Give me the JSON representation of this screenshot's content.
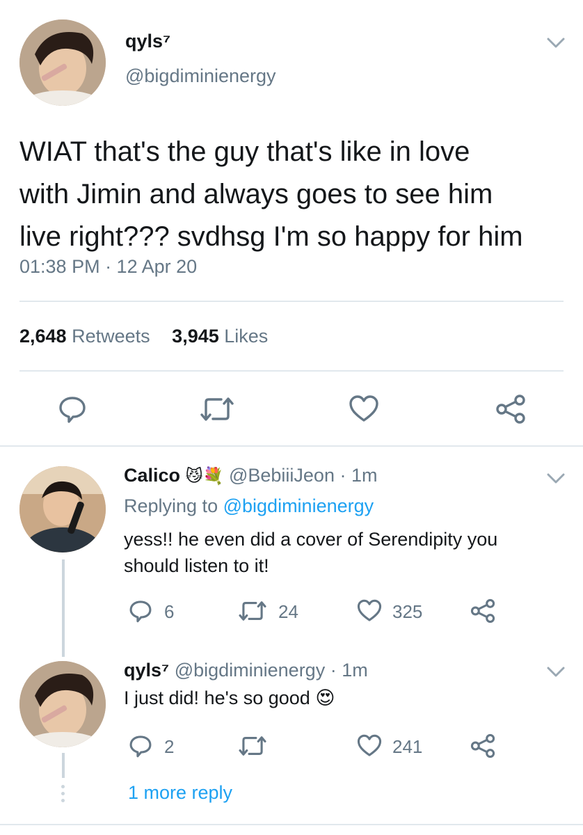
{
  "main_tweet": {
    "display_name": "qyls⁷",
    "handle": "@bigdiminienergy",
    "text_lines": [
      "WIAT that's the guy that's like in love",
      "with Jimin and always goes to see him",
      "live right??? svdhsg I'm so happy for him"
    ],
    "timestamp": "01:38 PM · 12 Apr 20",
    "retweets_count": "2,648",
    "retweets_label": "Retweets",
    "likes_count": "3,945",
    "likes_label": "Likes"
  },
  "reply1": {
    "display_name": "Calico",
    "emojis": "😼💐",
    "handle": "@BebiiiJeon",
    "time": "· 1m",
    "replying_label": "Replying to",
    "replying_handle": "@bigdiminienergy",
    "text_lines": [
      "yess!! he even did a cover of Serendipity you",
      "should listen to it!"
    ],
    "replies": "6",
    "retweets": "24",
    "likes": "325"
  },
  "reply2": {
    "display_name": "qyls⁷",
    "handle": "@bigdiminienergy",
    "time": "· 1m",
    "text": "I just did! he's so good",
    "emoji": "😍",
    "replies": "2",
    "likes": "241"
  },
  "more_replies_label": "1 more reply",
  "colors": {
    "accent": "#1da1f2",
    "secondary_text": "#657786",
    "divider": "#e1e8ed"
  },
  "icons": [
    "chevron-down-icon",
    "reply-icon",
    "retweet-icon",
    "like-icon",
    "share-icon"
  ]
}
